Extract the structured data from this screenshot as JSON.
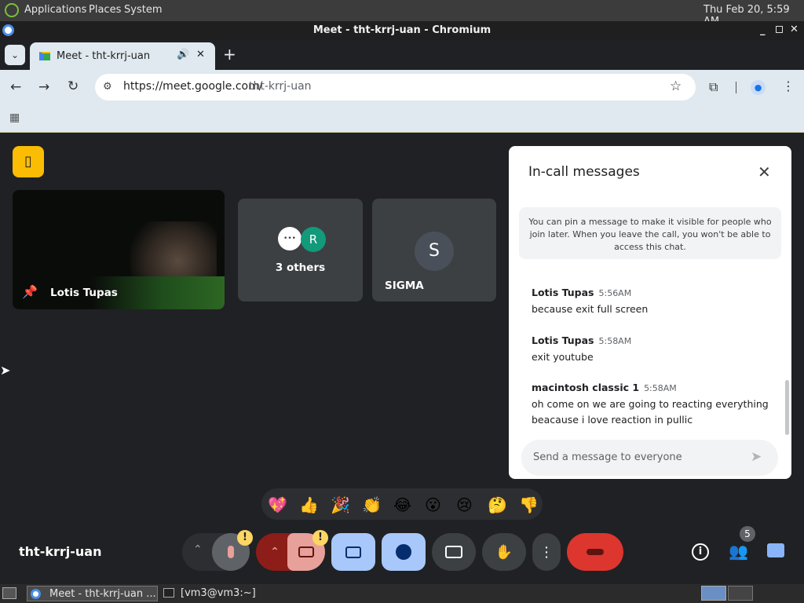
{
  "topbar": {
    "applications": "Applications",
    "places": "Places",
    "system": "System",
    "clock": "Thu Feb 20,  5:59 AM"
  },
  "window": {
    "title": "Meet - tht-krrj-uan - Chromium"
  },
  "tab": {
    "label": "Meet - tht-krrj-uan"
  },
  "omnibox": {
    "prefix": "https://meet.google.com/",
    "path": "tht-krrj-uan"
  },
  "tiles": [
    {
      "name": "Lotis Tupas"
    },
    {
      "avatar_left": "•••",
      "avatar_right": "R",
      "label": "3 others"
    },
    {
      "avatar": "S",
      "label": "SIGMA"
    }
  ],
  "chat": {
    "title": "In-call messages",
    "info": "You can pin a message to make it visible for people who join later. When you leave the call, you won't be able to access this chat.",
    "messages": [
      {
        "sender": "Lotis Tupas",
        "time": "5:56AM",
        "text": "because exit full screen"
      },
      {
        "sender": "Lotis Tupas",
        "time": "5:58AM",
        "text": "exit youtube"
      },
      {
        "sender": "macintosh classic 1",
        "time": "5:58AM",
        "text": "oh come on we are going to reacting everything",
        "text2": "beacause i love reaction in pullic"
      }
    ],
    "input_placeholder": "Send a message to everyone"
  },
  "reactions": [
    "💖",
    "👍",
    "🎉",
    "👏",
    "😂",
    "😮",
    "😢",
    "🤔",
    "👎"
  ],
  "meeting": {
    "code": "tht-krrj-uan",
    "people_count": "5"
  },
  "taskbar": {
    "item1": "Meet - tht-krrj-uan ...",
    "item2": "[vm3@vm3:~]"
  },
  "colors": {
    "end_call": "#ea4335",
    "accent": "#8ab4f8",
    "warning": "#fdd663"
  }
}
